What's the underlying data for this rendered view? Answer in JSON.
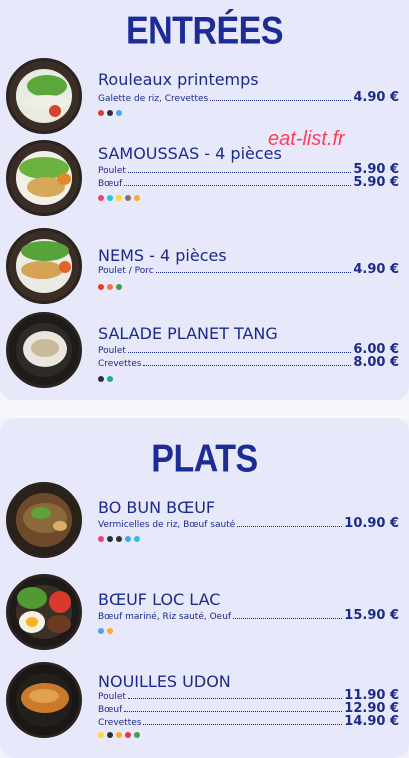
{
  "sections": {
    "entrees": {
      "title": "ENTRÉES"
    },
    "plats": {
      "title": "PLATS"
    }
  },
  "watermark": "eat-list.fr",
  "entrees": [
    {
      "name": "Rouleaux printemps",
      "rows": [
        {
          "label": "Galette de riz, Crevettes",
          "price": "4.90 €"
        }
      ],
      "allergens": [
        "#e53935",
        "#263238",
        "#42a5f5"
      ]
    },
    {
      "name": "SAMOUSSAS - 4 pièces",
      "rows": [
        {
          "label": "Poulet",
          "price": "5.90 €"
        },
        {
          "label": "Bœuf",
          "price": "5.90 €"
        }
      ],
      "allergens": [
        "#ec407a",
        "#26c6da",
        "#fdd835",
        "#8d6e63",
        "#ffa726"
      ]
    },
    {
      "name": "NEMS - 4 pièces",
      "rows": [
        {
          "label": "Poulet / Porc",
          "price": "4.90 €"
        }
      ],
      "allergens": [
        "#e53935",
        "#ff7043",
        "#43a047"
      ]
    },
    {
      "name": "SALADE PLANET TANG",
      "rows": [
        {
          "label": "Poulet",
          "price": "6.00 €"
        },
        {
          "label": "Crevettes",
          "price": "8.00 €"
        }
      ],
      "allergens": [
        "#263238",
        "#26a69a"
      ]
    }
  ],
  "plats": [
    {
      "name": "BO BUN BŒUF",
      "rows": [
        {
          "label": "Vermicelles de riz, Bœuf sauté",
          "price": "10.90 €"
        }
      ],
      "allergens": [
        "#ec407a",
        "#263238",
        "#263238",
        "#42a5f5",
        "#26c6da"
      ]
    },
    {
      "name": "BŒUF LOC LAC",
      "rows": [
        {
          "label": "Bœuf mariné, Riz sauté, Oeuf",
          "price": "15.90 €"
        }
      ],
      "allergens": [
        "#42a5f5",
        "#ffa726"
      ]
    },
    {
      "name": "NOUILLES UDON",
      "rows": [
        {
          "label": "Poulet",
          "price": "11.90 €"
        },
        {
          "label": "Bœuf",
          "price": "12.90 €"
        },
        {
          "label": "Crevettes",
          "price": "14.90 €"
        }
      ],
      "allergens": [
        "#fdd835",
        "#263238",
        "#ffa726",
        "#e53935",
        "#43a047"
      ]
    }
  ]
}
